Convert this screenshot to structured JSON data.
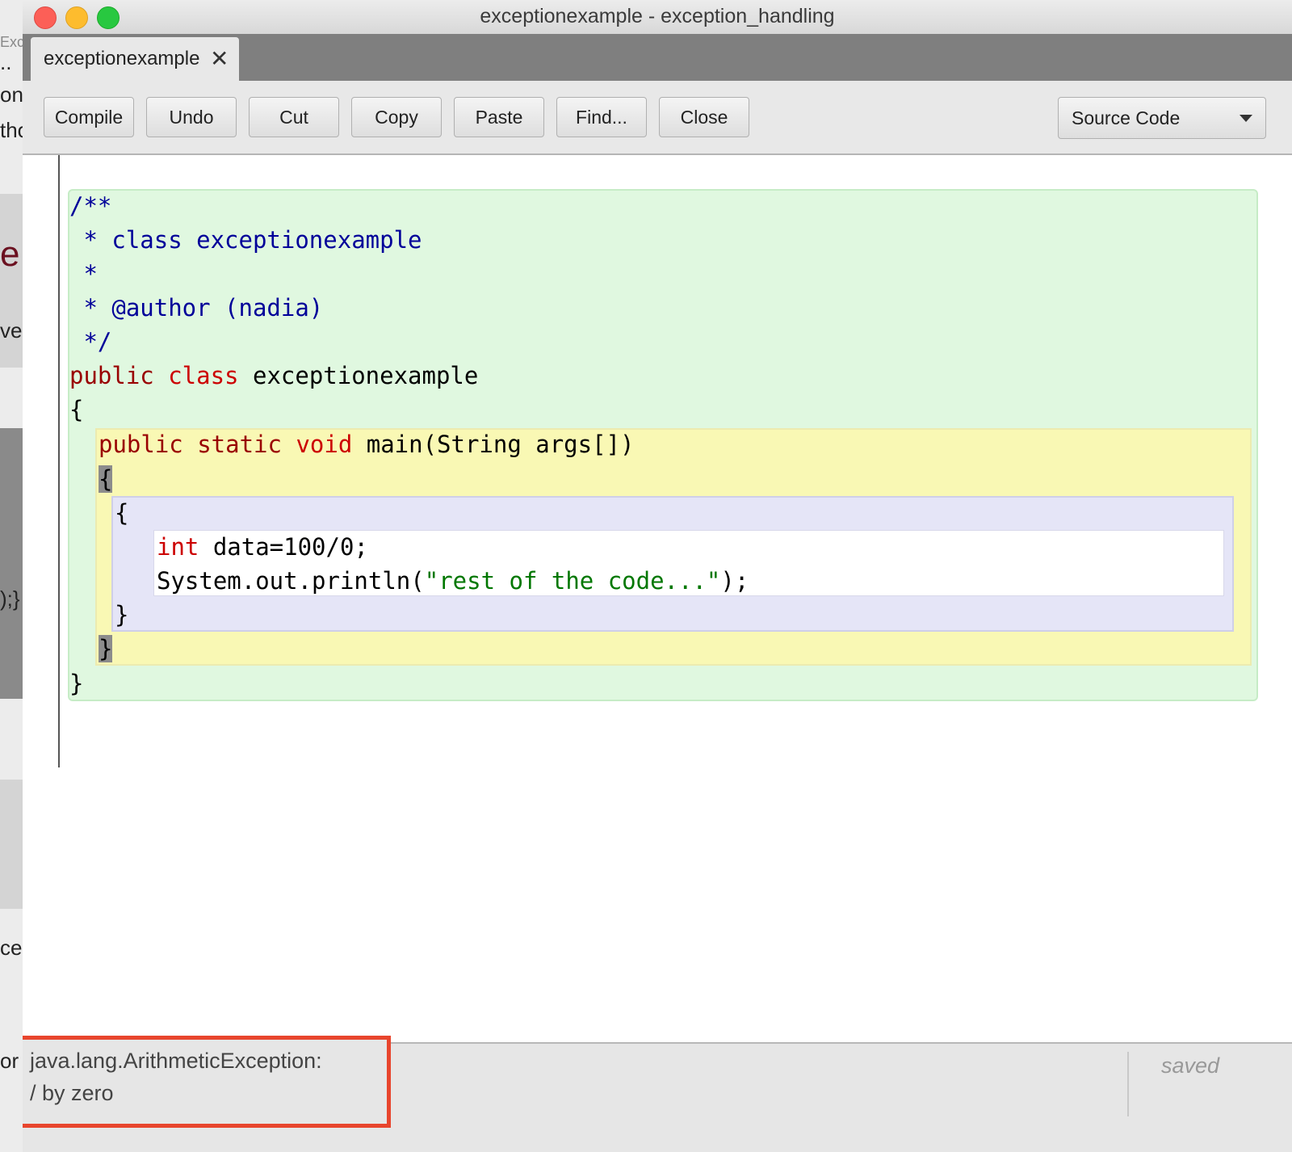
{
  "background": {
    "fragments": [
      "Exc",
      "..",
      "on",
      "tho",
      "e",
      "ve",
      ");}",
      "ce",
      "or"
    ]
  },
  "window": {
    "title": "exceptionexample - exception_handling"
  },
  "tab": {
    "label": "exceptionexample",
    "close_glyph": "✕"
  },
  "toolbar": {
    "compile": "Compile",
    "undo": "Undo",
    "cut": "Cut",
    "copy": "Copy",
    "paste": "Paste",
    "find": "Find...",
    "close": "Close",
    "view_select": "Source Code"
  },
  "code": {
    "l1": "/**",
    "l2": " * class exceptionexample",
    "l3": " *",
    "l4": " * @author (nadia)",
    "l5": " */",
    "l6_kw1": "public ",
    "l6_kw2": "class ",
    "l6_name": "exceptionexample",
    "l7": "{",
    "l8_kw1": "public static ",
    "l8_kw2": "void ",
    "l8_rest": "main(String args[])",
    "l9": "{",
    "l10": "{",
    "l11_kw": "int ",
    "l11_rest": "data=100/0;",
    "l12_a": "System.out.println(",
    "l12_str": "\"rest of the code...\"",
    "l12_b": ");",
    "l13": "}",
    "l14": "}",
    "l15": "}"
  },
  "status": {
    "error_line1": "java.lang.ArithmeticException:",
    "error_line2": "/ by zero",
    "saved": "saved"
  },
  "colors": {
    "comment": "#000099",
    "keyword": "#990000",
    "type": "#cc0000",
    "string": "#007700",
    "class_scope": "#e0f8e0",
    "method_scope": "#f9f8b4",
    "block_scope": "#e5e5f7",
    "error_highlight": "#e8452d"
  }
}
